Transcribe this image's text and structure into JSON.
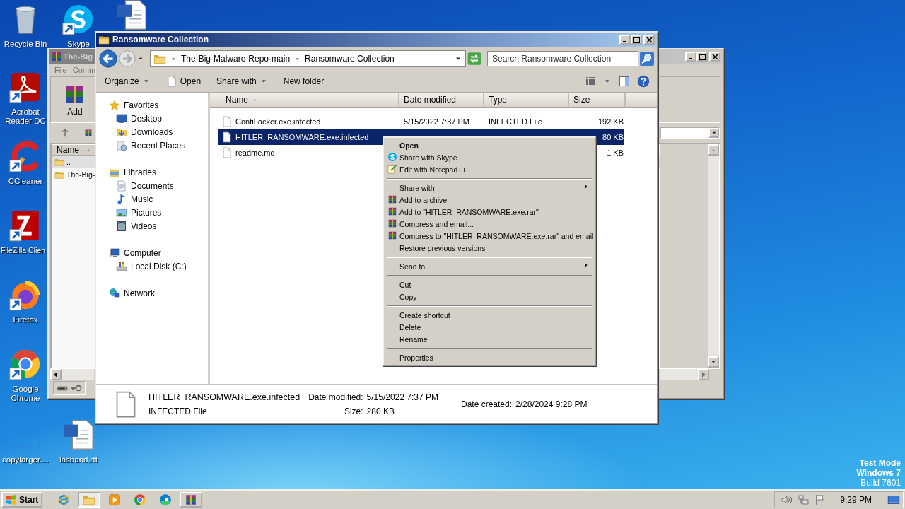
{
  "desktop_icons": [
    {
      "label": "Recycle Bin",
      "kind": "recycle",
      "shortcut": false
    },
    {
      "label": "Skype",
      "kind": "skype",
      "shortcut": true
    },
    {
      "kind": "word",
      "shortcut": false
    },
    {
      "label": "Acrobat Reader DC",
      "kind": "acrobat",
      "shortcut": true
    },
    {
      "label": "CCleaner",
      "kind": "ccleaner",
      "shortcut": true
    },
    {
      "label": "FileZilla Clien",
      "kind": "filezilla",
      "shortcut": true
    },
    {
      "label": "Firefox",
      "kind": "firefox",
      "shortcut": true
    },
    {
      "label": "Google Chrome",
      "kind": "chrome",
      "shortcut": true
    },
    {
      "label": "copylarger....",
      "kind": "blank",
      "shortcut": false
    },
    {
      "label": "lasband.rtf",
      "kind": "word",
      "shortcut": false
    }
  ],
  "back_window": {
    "title": "The-Big",
    "menu": [
      "File",
      "Comm"
    ],
    "toolbar": [
      "Add"
    ],
    "column": {
      "label": "Name",
      "sorted": true
    },
    "rows": [
      "..",
      "The-Big-"
    ]
  },
  "explorer": {
    "title": "Ransomware Collection",
    "breadcrumbs": [
      "The-Big-Malware-Repo-main",
      "Ransomware Collection"
    ],
    "search": {
      "placeholder": "Search Ransomware Collection"
    },
    "toolbar": [
      {
        "label": "Organize",
        "kind": "dropdown"
      },
      {
        "label": "Open",
        "kind": "icon"
      },
      {
        "label": "Share with",
        "kind": "dropdown"
      },
      {
        "label": "New folder",
        "kind": "plain"
      }
    ],
    "nav": [
      {
        "label": "Favorites",
        "children": [
          {
            "label": "Desktop"
          },
          {
            "label": "Downloads"
          },
          {
            "label": "Recent Places"
          }
        ]
      },
      {
        "label": "Libraries",
        "children": [
          {
            "label": "Documents"
          },
          {
            "label": "Music"
          },
          {
            "label": "Pictures"
          },
          {
            "label": "Videos"
          }
        ]
      },
      {
        "label": "Computer",
        "children": [
          {
            "label": "Local Disk (C:)"
          }
        ]
      },
      {
        "label": "Network"
      }
    ],
    "columns": [
      {
        "label": "Name",
        "sorted": true
      },
      {
        "label": "Date modified",
        "sorted": false
      },
      {
        "label": "Type",
        "sorted": false
      },
      {
        "label": "Size",
        "sorted": false
      }
    ],
    "files": [
      {
        "name": "ContiLocker.exe.infected",
        "date": "5/15/2022 7:37 PM",
        "type": "INFECTED File",
        "size": "192 KB",
        "selected": false
      },
      {
        "name": "HITLER_RANSOMWARE.exe.infected",
        "size": "80 KB",
        "selected": true
      },
      {
        "name": "readme.md",
        "size": "1 KB",
        "selected": false
      }
    ],
    "details": {
      "name": "HITLER_RANSOMWARE.exe.infected",
      "type": "INFECTED File",
      "fields": [
        {
          "label": "Date modified:",
          "value": "5/15/2022 7:37 PM"
        },
        {
          "label": "Size:",
          "value": "280 KB"
        },
        {
          "label": "Date created:",
          "value": "2/28/2024 9:28 PM"
        }
      ]
    }
  },
  "context_menu": [
    {
      "label": "Open",
      "kind": "default"
    },
    {
      "label": "Share with Skype",
      "kind": "skype"
    },
    {
      "label": "Edit with Notepad++",
      "kind": "notepad"
    },
    {
      "kind": "separator"
    },
    {
      "label": "Share with",
      "kind": "submenu"
    },
    {
      "label": "Add to archive...",
      "kind": "winrar"
    },
    {
      "label": "Add to \"HITLER_RANSOMWARE.exe.rar\"",
      "kind": "winrar"
    },
    {
      "label": "Compress and email...",
      "kind": "winrar"
    },
    {
      "label": "Compress to \"HITLER_RANSOMWARE.exe.rar\" and email",
      "kind": "winrar"
    },
    {
      "label": "Restore previous versions",
      "kind": "plain"
    },
    {
      "kind": "separator"
    },
    {
      "label": "Send to",
      "kind": "submenu"
    },
    {
      "kind": "separator"
    },
    {
      "label": "Cut",
      "kind": "plain"
    },
    {
      "label": "Copy",
      "kind": "plain"
    },
    {
      "kind": "separator"
    },
    {
      "label": "Create shortcut",
      "kind": "plain"
    },
    {
      "label": "Delete",
      "kind": "plain"
    },
    {
      "label": "Rename",
      "kind": "plain"
    },
    {
      "kind": "separator"
    },
    {
      "label": "Properties",
      "kind": "plain"
    }
  ],
  "desktop_notice": [
    {
      "text": "Test Mode",
      "kind": "bold"
    },
    {
      "text": "Windows 7",
      "kind": "bold"
    },
    {
      "text": "Build 7601",
      "kind": "plain"
    }
  ],
  "taskbar": {
    "start": "Start",
    "apps": [
      {
        "kind": "ie",
        "running": false,
        "selected": false
      },
      {
        "kind": "explorer",
        "running": true,
        "selected": true
      },
      {
        "kind": "media",
        "running": false,
        "selected": false
      },
      {
        "kind": "chrome",
        "running": false,
        "selected": false
      },
      {
        "kind": "edge",
        "running": false,
        "selected": false
      },
      {
        "kind": "winrar",
        "running": true,
        "selected": false
      }
    ],
    "clock": "9:29 PM"
  }
}
